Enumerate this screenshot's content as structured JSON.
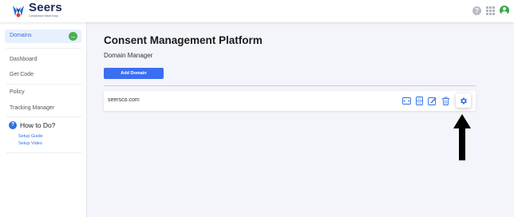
{
  "brand": {
    "name": "Seers",
    "tagline": "Compliance Made Easy"
  },
  "topbar_icons": [
    "help-icon",
    "apps-grid-icon",
    "user-avatar-icon"
  ],
  "sidebar": {
    "active_item": "Domains",
    "items": [
      "Dashboard",
      "Get Code",
      "Policy",
      "Tracking Manager"
    ],
    "howto": {
      "title": "How to Do?",
      "links": [
        "Setup Guide",
        "Setup Video"
      ]
    }
  },
  "main": {
    "title": "Consent Management Platform",
    "subtitle": "Domain Manager",
    "add_button": "Add Domain",
    "domains": [
      {
        "name": "seersco.com",
        "actions": [
          "code-icon",
          "database-icon",
          "edit-icon",
          "trash-icon",
          "gear-icon"
        ]
      }
    ]
  },
  "colors": {
    "accent": "#3b6ff2",
    "active_nav_bg": "#e8f0fe",
    "success": "#4caf50",
    "page_bg": "#f4f5fb"
  }
}
